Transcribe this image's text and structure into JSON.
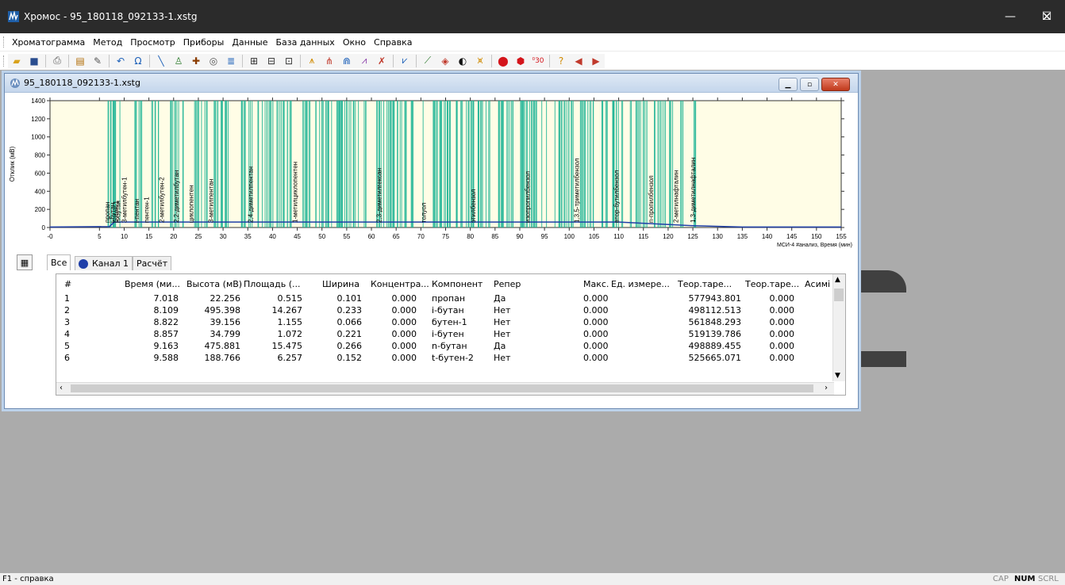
{
  "app": {
    "title": "Хромос - 95_180118_092133-1.xstg"
  },
  "menu": [
    "Хроматограмма",
    "Метод",
    "Просмотр",
    "Приборы",
    "Данные",
    "База данных",
    "Окно",
    "Справка"
  ],
  "child_window": {
    "title": "95_180118_092133-1.xstg"
  },
  "chart_data": {
    "type": "line",
    "ylabel": "Отклик (мВ)",
    "xlabel": "МСИ-4 #анализ, Время (мин)",
    "xlim": [
      -5,
      155
    ],
    "ylim": [
      0,
      1400
    ],
    "x_ticks": [
      "-0",
      "5",
      "10",
      "15",
      "20",
      "25",
      "30",
      "35",
      "40",
      "45",
      "50",
      "55",
      "60",
      "65",
      "70",
      "75",
      "80",
      "85",
      "90",
      "95",
      "100",
      "105",
      "110",
      "115",
      "120",
      "125",
      "130",
      "135",
      "140",
      "145",
      "150",
      "155"
    ],
    "y_ticks": [
      "0",
      "200",
      "400",
      "600",
      "800",
      "1000",
      "1200",
      "1400"
    ],
    "peak_labels": [
      {
        "t": 7.0,
        "label": "пропан"
      },
      {
        "t": 8.1,
        "label": "i-бутан"
      },
      {
        "t": 8.8,
        "label": "бутен-1"
      },
      {
        "t": 9.2,
        "label": "n-бутан"
      },
      {
        "t": 10.5,
        "label": "3-метилбутен-1"
      },
      {
        "t": 13.0,
        "label": "i-пентан"
      },
      {
        "t": 15.0,
        "label": "пентен-1"
      },
      {
        "t": 18.0,
        "label": "2-метилбутен-2"
      },
      {
        "t": 21.0,
        "label": "2,2-диметилбутан"
      },
      {
        "t": 24.0,
        "label": "циклопентен"
      },
      {
        "t": 28.0,
        "label": "3-метилпентан"
      },
      {
        "t": 36.0,
        "label": "2,4-диметилпентан"
      },
      {
        "t": 45.0,
        "label": "1-метилциклопентен"
      },
      {
        "t": 62.0,
        "label": "2,3-диметилгексан"
      },
      {
        "t": 71.0,
        "label": "толуол"
      },
      {
        "t": 81.0,
        "label": "этилбензол"
      },
      {
        "t": 92.0,
        "label": "изопропилбензол"
      },
      {
        "t": 102.0,
        "label": "1,3,5-триметилбензол"
      },
      {
        "t": 110.0,
        "label": "втор-бутилбензол"
      },
      {
        "t": 117.0,
        "label": "n-пропилбензол"
      },
      {
        "t": 122.0,
        "label": "2-метилнафталин"
      },
      {
        "t": 125.5,
        "label": "1,3-диметилнафталин"
      }
    ]
  },
  "tabs": [
    {
      "label": "Все"
    },
    {
      "label": "Канал 1"
    },
    {
      "label": "Расчёт"
    }
  ],
  "table": {
    "columns": [
      "#",
      "Время (ми...",
      "Высота (мВ)",
      "Площадь (...",
      "Ширина",
      "Концентра...",
      "Компонент",
      "Репер",
      "Макс.",
      "Ед. измере...",
      "Теор.таре...",
      "Теор.таре...",
      "Асимі"
    ],
    "rows": [
      [
        "1",
        "7.018",
        "22.256",
        "0.515",
        "0.101",
        "0.000",
        "пропан",
        "Да",
        "0.000",
        "",
        "577943.801",
        "0.000",
        ""
      ],
      [
        "2",
        "8.109",
        "495.398",
        "14.267",
        "0.233",
        "0.000",
        "i-бутан",
        "Нет",
        "0.000",
        "",
        "498112.513",
        "0.000",
        ""
      ],
      [
        "3",
        "8.822",
        "39.156",
        "1.155",
        "0.066",
        "0.000",
        "бутен-1",
        "Нет",
        "0.000",
        "",
        "561848.293",
        "0.000",
        ""
      ],
      [
        "4",
        "8.857",
        "34.799",
        "1.072",
        "0.221",
        "0.000",
        "i-бутен",
        "Нет",
        "0.000",
        "",
        "519139.786",
        "0.000",
        ""
      ],
      [
        "5",
        "9.163",
        "475.881",
        "15.475",
        "0.266",
        "0.000",
        "n-бутан",
        "Да",
        "0.000",
        "",
        "498889.455",
        "0.000",
        ""
      ],
      [
        "6",
        "9.588",
        "188.766",
        "6.257",
        "0.152",
        "0.000",
        "t-бутен-2",
        "Нет",
        "0.000",
        "",
        "525665.071",
        "0.000",
        ""
      ]
    ]
  },
  "status": {
    "help": "F1 - справка",
    "cap": "CAP",
    "num": "NUM",
    "scrl": "SCRL"
  }
}
